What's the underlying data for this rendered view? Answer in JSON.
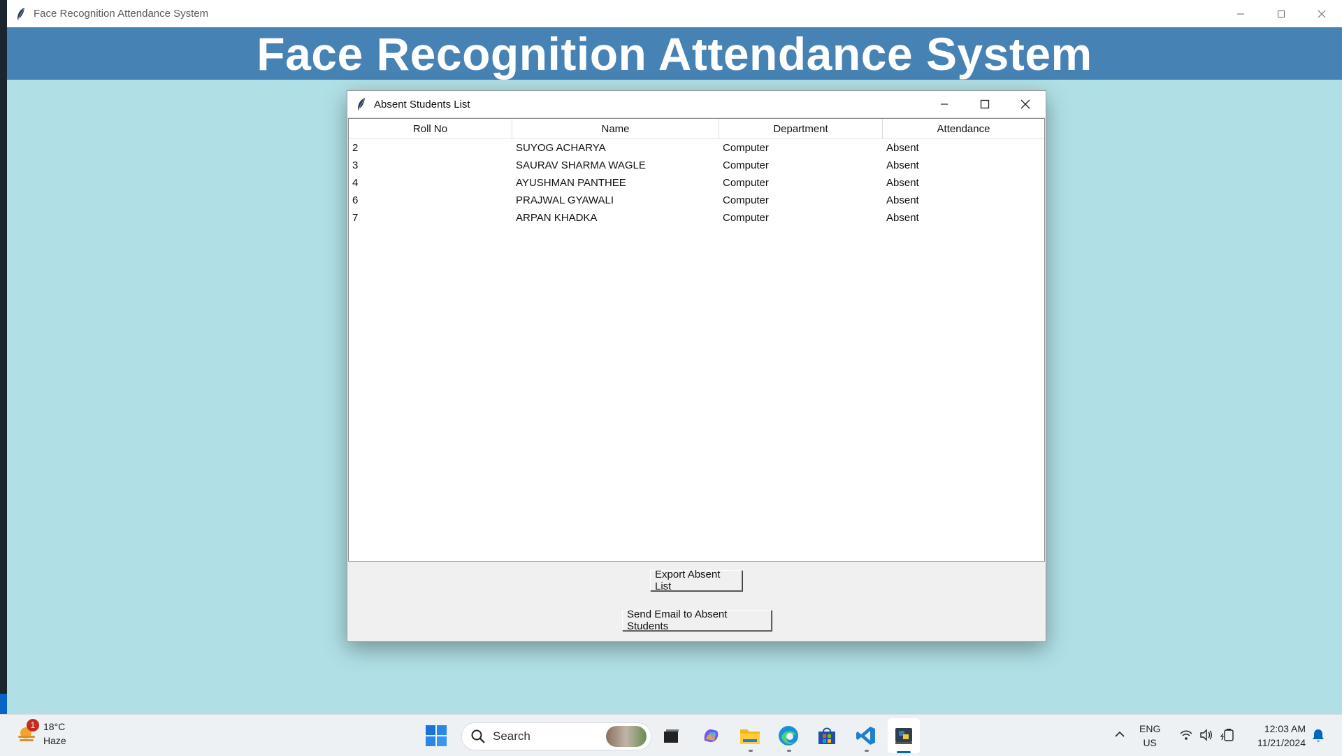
{
  "main_window": {
    "title": "Face Recognition Attendance System",
    "heading": "Face Recognition Attendance System",
    "colors": {
      "banner": "#4682b4",
      "background": "#b0e0e6"
    }
  },
  "dialog": {
    "title": "Absent Students List",
    "columns": [
      "Roll No",
      "Name",
      "Department",
      "Attendance"
    ],
    "rows": [
      [
        "2",
        "SUYOG ACHARYA",
        "Computer",
        "Absent"
      ],
      [
        "3",
        "SAURAV SHARMA WAGLE",
        "Computer",
        "Absent"
      ],
      [
        "4",
        "AYUSHMAN PANTHEE",
        "Computer",
        "Absent"
      ],
      [
        "6",
        "PRAJWAL GYAWALI",
        "Computer",
        "Absent"
      ],
      [
        "7",
        "ARPAN KHADKA",
        "Computer",
        "Absent"
      ]
    ],
    "export_button": "Export Absent List",
    "email_button": "Send Email to Absent Students"
  },
  "taskbar": {
    "weather": {
      "badge": "1",
      "temp": "18°C",
      "condition": "Haze"
    },
    "search_placeholder": "Search",
    "pinned_icons": [
      "start-icon",
      "task-view-icon",
      "copilot-icon",
      "file-explorer-icon",
      "edge-icon",
      "store-icon",
      "vscode-icon",
      "python-icon"
    ],
    "language": {
      "line1": "ENG",
      "line2": "US"
    },
    "clock": {
      "time": "12:03 AM",
      "date": "11/21/2024"
    }
  }
}
